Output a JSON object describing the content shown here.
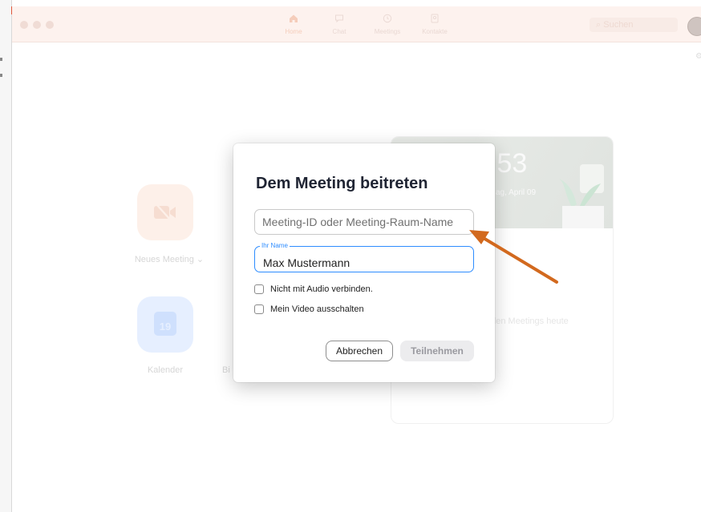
{
  "titlebar": {
    "nav": [
      {
        "label": "Home",
        "icon": "home-icon"
      },
      {
        "label": "Chat",
        "icon": "chat-icon"
      },
      {
        "label": "Meetings",
        "icon": "clock-icon"
      },
      {
        "label": "Kontakte",
        "icon": "contacts-icon"
      }
    ],
    "search_label": "Suchen"
  },
  "background": {
    "tiles": [
      {
        "label": "Neues Meeting",
        "icon": "video-off-icon"
      },
      {
        "label": "Kalender",
        "icon": "calendar-icon",
        "day": "19"
      }
    ],
    "partial_label": "Bi",
    "card": {
      "time": ":53",
      "date": "ag, April 09",
      "message": "nden Meetings heute"
    }
  },
  "dialog": {
    "title": "Dem Meeting beitreten",
    "meeting_id": {
      "value": "",
      "placeholder": "Meeting-ID oder Meeting-Raum-Name"
    },
    "name": {
      "legend": "Ihr Name",
      "value": "Max Mustermann"
    },
    "checkboxes": [
      {
        "label": "Nicht mit Audio verbinden.",
        "checked": false
      },
      {
        "label": "Mein Video ausschalten",
        "checked": false
      }
    ],
    "cancel_label": "Abbrechen",
    "join_label": "Teilnehmen"
  },
  "colors": {
    "accent": "#2d8cff",
    "annotation_arrow": "#d2691e",
    "titlebar_bg": "#fdf2ee"
  }
}
